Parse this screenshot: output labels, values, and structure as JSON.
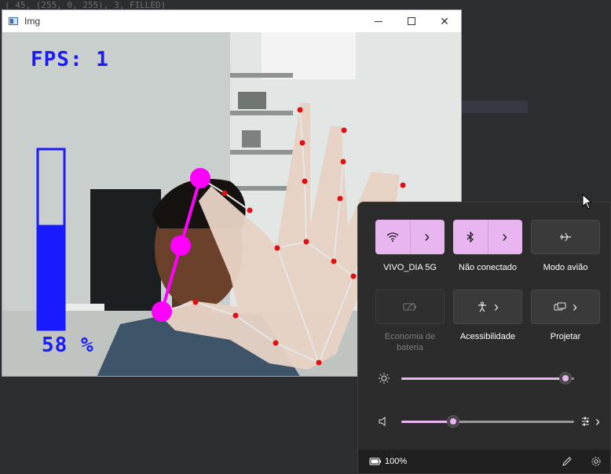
{
  "ide": {
    "code_line": "(  45,  (255, 0, 255),      3, FILLED)"
  },
  "window": {
    "title": "Img",
    "minimize_icon": "minimize-icon",
    "maximize_icon": "maximize-icon",
    "close_glyph": "✕"
  },
  "overlay": {
    "fps_text": "FPS: 1",
    "volume_percent_text": "58 %",
    "volume_bar_level": 0.58,
    "accent_blue": "#1a1aff",
    "accent_magenta": "#ff00ff"
  },
  "quick_settings": {
    "tiles": [
      {
        "label": "VIVO_DIA 5G",
        "icon": "wifi-icon",
        "state": "on",
        "chevron": "›"
      },
      {
        "label": "Não conectado",
        "icon": "bluetooth-icon",
        "state": "on",
        "chevron": "›"
      },
      {
        "label": "Modo avião",
        "icon": "airplane-icon",
        "state": "off"
      },
      {
        "label": "Economia de bateria",
        "label_line1": "Economia de",
        "label_line2": "bateria",
        "icon": "battery-saver-icon",
        "state": "disabled"
      },
      {
        "label": "Acessibilidade",
        "icon": "accessibility-icon",
        "state": "off",
        "chevron": "›"
      },
      {
        "label": "Projetar",
        "icon": "project-icon",
        "state": "off",
        "chevron": "›"
      }
    ],
    "brightness": {
      "icon": "brightness-icon",
      "level": 0.95
    },
    "volume": {
      "icon": "speaker-icon",
      "level": 0.3,
      "mixer_glyph": "›"
    },
    "battery": {
      "icon": "battery-icon",
      "text": "100%"
    },
    "edit_icon": "pencil-icon",
    "settings_icon": "gear-icon",
    "accent": "#e8b5f0"
  }
}
